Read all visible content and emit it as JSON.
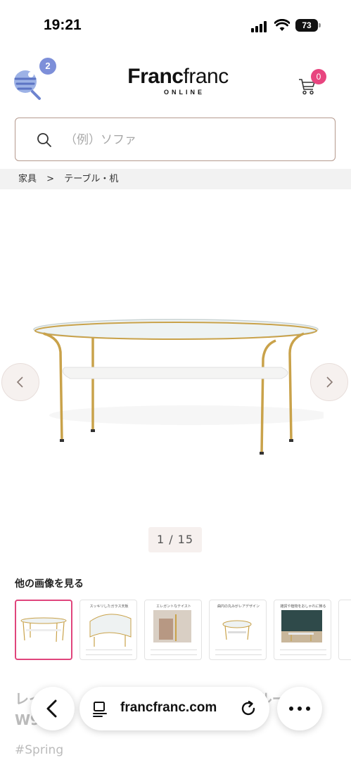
{
  "status_bar": {
    "time": "19:21",
    "battery": "73"
  },
  "header": {
    "notification_count": "2",
    "logo_bold": "Franc",
    "logo_light": "franc",
    "logo_sub": "ONLINE",
    "cart_count": "0"
  },
  "search": {
    "placeholder": "（例）ソファ"
  },
  "breadcrumb": {
    "items": [
      "家具",
      ">",
      "テーブル・机"
    ]
  },
  "gallery": {
    "counter": "1 / 15"
  },
  "more_images": {
    "title": "他の画像を見る",
    "thumbnails": [
      {
        "caption": ""
      },
      {
        "caption": "スッキリしたガラス天板"
      },
      {
        "caption": "エレガントなテイスト"
      },
      {
        "caption": "曲円の丸みがレアデザイン"
      },
      {
        "caption": "雑貨や植物をおしゃれに飾る"
      }
    ]
  },
  "product": {
    "title": "レイ　　　　テーブル【ゴールド】 ブルー　　W90"
  },
  "hashtag": "#Spring",
  "browser": {
    "url": "francfranc.com"
  },
  "colors": {
    "accent_pink": "#e8457f",
    "badge_blue": "#7d8fd9",
    "search_border": "#b59a8e"
  }
}
